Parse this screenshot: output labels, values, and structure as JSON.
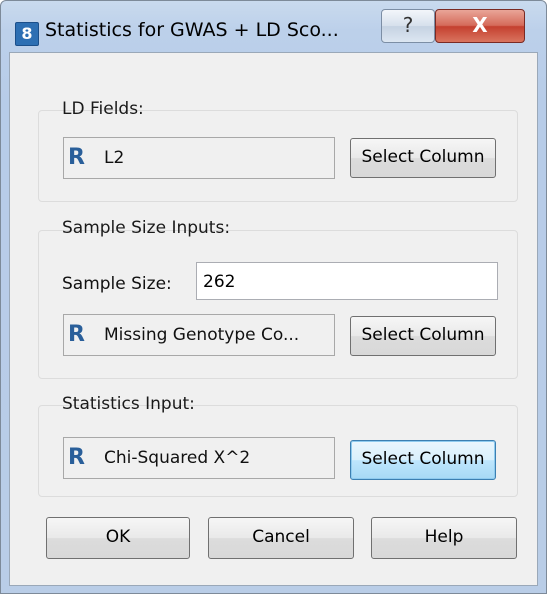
{
  "window": {
    "title": "Statistics for GWAS + LD Sco...",
    "help_glyph": "?",
    "close_glyph": "X",
    "app_icon_glyph": "8"
  },
  "ld_fields": {
    "label": "LD Fields:",
    "field_icon": "R",
    "field_value": "L2",
    "select_label": "Select Column"
  },
  "sample_size_inputs": {
    "label": "Sample Size Inputs:",
    "sample_size_label": "Sample Size:",
    "sample_size_value": "262",
    "field_icon": "R",
    "field_value": "Missing Genotype Co...",
    "select_label": "Select Column"
  },
  "statistics_input": {
    "label": "Statistics Input:",
    "field_icon": "R",
    "field_value": "Chi-Squared  X^2",
    "select_label": "Select Column"
  },
  "buttons": {
    "ok": "OK",
    "cancel": "Cancel",
    "help": "Help"
  }
}
